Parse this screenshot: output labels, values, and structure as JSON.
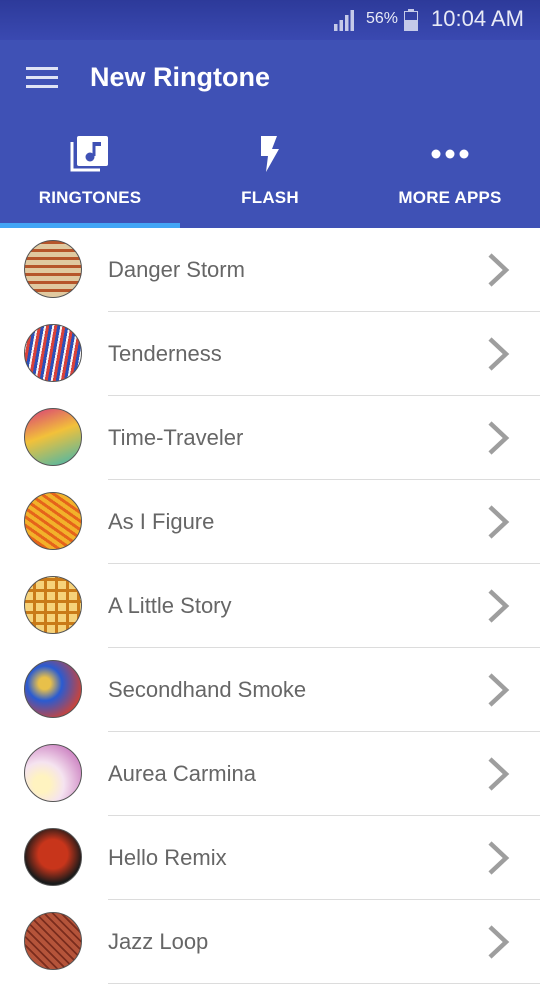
{
  "status_bar": {
    "battery": "56%",
    "time": "10:04 AM"
  },
  "app_bar": {
    "title": "New Ringtone"
  },
  "tabs": [
    {
      "label": "RINGTONES",
      "icon": "music-library-icon",
      "selected": true
    },
    {
      "label": "FLASH",
      "icon": "flash-icon",
      "selected": false
    },
    {
      "label": "MORE APPS",
      "icon": "more-dots-icon",
      "selected": false
    }
  ],
  "ringtones": [
    {
      "name": "Danger Storm",
      "art_colors": [
        "#e0c9a0",
        "#b6552a"
      ]
    },
    {
      "name": "Tenderness",
      "art_colors": [
        "#2b4fb8",
        "#d8413a"
      ]
    },
    {
      "name": "Time-Traveler",
      "art_colors": [
        "#d83a7a",
        "#3fb6b0"
      ]
    },
    {
      "name": "As I Figure",
      "art_colors": [
        "#f2b12a",
        "#e5641a"
      ]
    },
    {
      "name": "A Little Story",
      "art_colors": [
        "#f6d27a",
        "#c97a18"
      ]
    },
    {
      "name": "Secondhand Smoke",
      "art_colors": [
        "#2a5bd1",
        "#d9412c"
      ]
    },
    {
      "name": "Aurea Carmina",
      "art_colors": [
        "#f5e3f0",
        "#c46db8"
      ]
    },
    {
      "name": "Hello Remix",
      "art_colors": [
        "#c8351b",
        "#1a1a1a"
      ]
    },
    {
      "name": "Jazz Loop",
      "art_colors": [
        "#b5543a",
        "#7a2c1d"
      ]
    }
  ],
  "colors": {
    "primary": "#3f51b5",
    "tab_indicator": "#42a5f5",
    "list_text": "#666666",
    "chevron": "#9e9e9e"
  }
}
